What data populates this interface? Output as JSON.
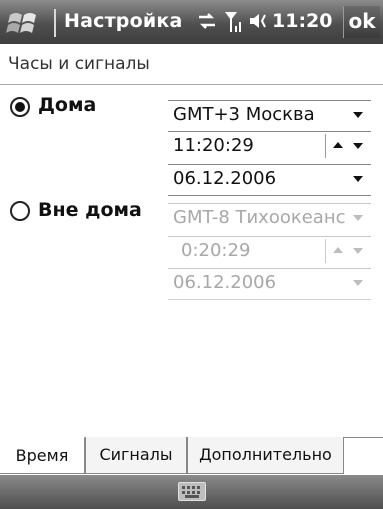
{
  "titlebar": {
    "title": "Настройка",
    "time": "11:20",
    "ok_label": "ok",
    "icons": [
      "windows-start-icon",
      "connectivity-icon",
      "signal-icon",
      "volume-icon"
    ]
  },
  "subtitle": "Часы и сигналы",
  "home": {
    "label": "Дома",
    "selected": true,
    "timezone": "GMT+3 Москва",
    "time": "11:20:29",
    "date": "06.12.2006"
  },
  "away": {
    "label": "Вне дома",
    "selected": false,
    "timezone": "GMT-8 Тихоокеанс",
    "time": "0:20:29",
    "date": "06.12.2006"
  },
  "tabs": [
    {
      "label": "Время",
      "active": true
    },
    {
      "label": "Сигналы",
      "active": false
    },
    {
      "label": "Дополнительно",
      "active": false
    }
  ],
  "menubar": {
    "icon": "keyboard-icon"
  }
}
